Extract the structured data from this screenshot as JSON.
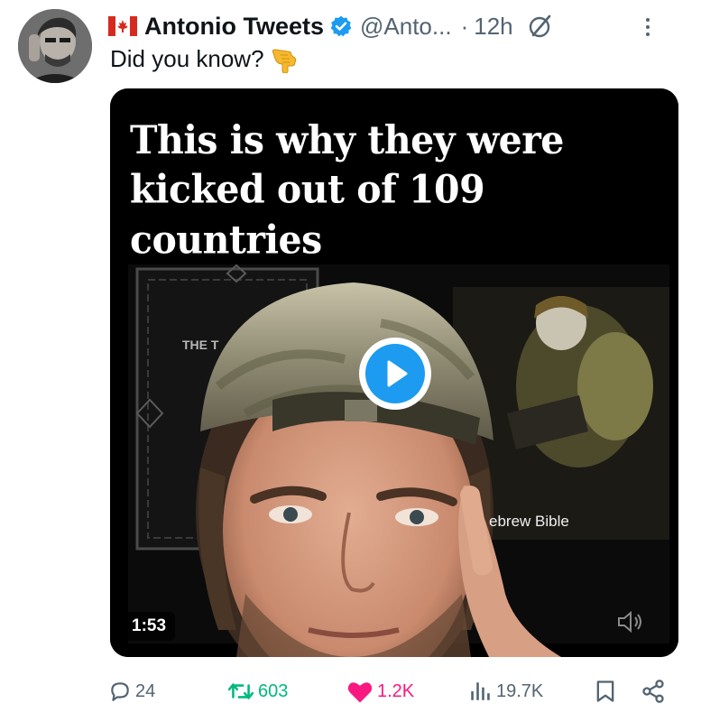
{
  "tweet": {
    "author_name": "Antonio Tweets",
    "handle": "@Anto...",
    "separator": "·",
    "time": "12h",
    "text": "Did you know?",
    "media": {
      "caption": "This is why they were kicked out of 109 countries",
      "overlay_label": "ebrew Bible",
      "book_label": "THE T",
      "duration": "1:53"
    },
    "actions": {
      "replies": "24",
      "reposts": "603",
      "likes": "1.2K",
      "views": "19.7K"
    }
  },
  "icons": {
    "flag": "canada-flag-icon",
    "verified": "verified-badge-icon",
    "grok": "grok-icon",
    "more": "more-options-icon",
    "pointer": "pointing-hand-emoji",
    "play": "play-icon",
    "volume": "volume-icon",
    "reply": "reply-icon",
    "repost": "repost-icon",
    "like": "heart-icon",
    "views": "views-icon",
    "bookmark": "bookmark-icon",
    "share": "share-icon"
  },
  "colors": {
    "accent": "#1d9bf0",
    "repost": "#00ba7c",
    "like": "#f91880",
    "muted": "#536471",
    "text": "#0f1419"
  }
}
